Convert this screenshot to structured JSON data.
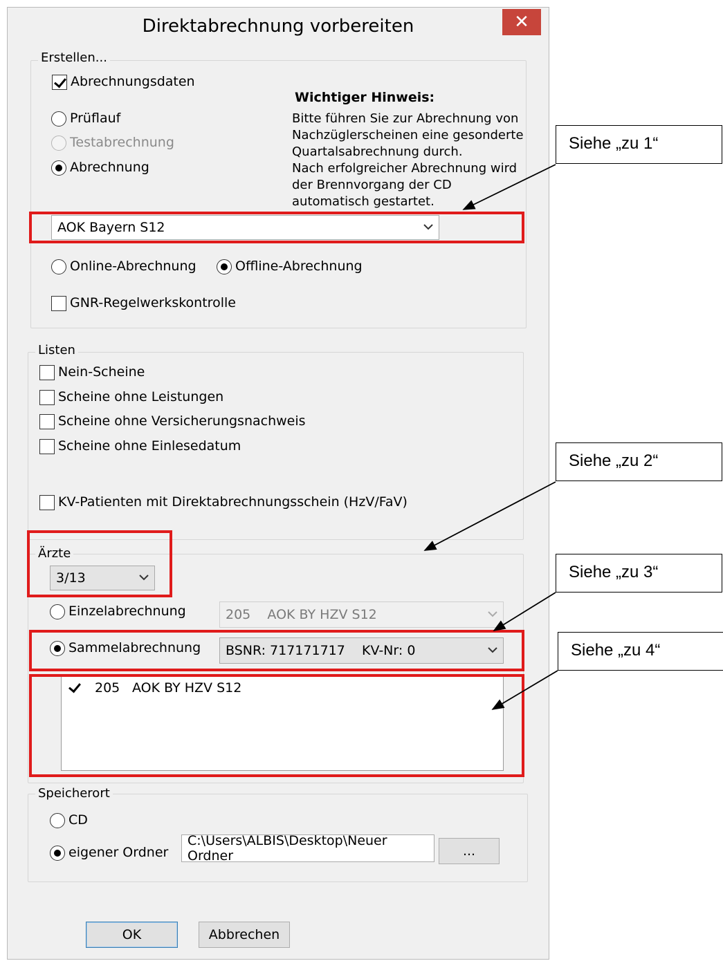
{
  "window": {
    "title": "Direktabrechnung vorbereiten",
    "close_label": "✕"
  },
  "erstellen": {
    "legend": "Erstellen...",
    "abrechnungsdaten_label": "Abrechnungsdaten",
    "abrechnungsdaten_checked": true,
    "hint_title": "Wichtiger Hinweis:",
    "hint_lines": [
      "Bitte führen Sie zur Abrechnung von",
      "Nachzüglerscheinen eine gesonderte",
      "Quartalsabrechnung durch.",
      "Nach erfolgreicher Abrechnung wird",
      "der Brennvorgang der CD",
      "automatisch gestartet."
    ],
    "mode_options": [
      "Prüflauf",
      "Testabrechnung",
      "Abrechnung"
    ],
    "mode_selected": "Abrechnung",
    "kasse_value": "AOK Bayern S12",
    "online_label": "Online-Abrechnung",
    "offline_label": "Offline-Abrechnung",
    "transfer_selected": "Offline-Abrechnung",
    "gnr_label": "GNR-Regelwerkskontrolle",
    "gnr_checked": false
  },
  "listen": {
    "legend": "Listen",
    "items": [
      "Nein-Scheine",
      "Scheine ohne Leistungen",
      "Scheine ohne Versicherungsnachweis",
      "Scheine ohne Einlesedatum"
    ],
    "kv_label": "KV-Patienten mit Direktabrechnungsschein (HzV/FaV)"
  },
  "aerzte": {
    "legend": "Ärzte",
    "select_value": "3/13",
    "einzel_label": "Einzelabrechnung",
    "einzel_value": "205    AOK BY HZV S12",
    "sammel_label": "Sammelabrechnung",
    "sammel_value": "BSNR: 717171717    KV-Nr: 0",
    "mode_selected": "Sammelabrechnung",
    "list_items": [
      {
        "nr": "205",
        "name": "AOK BY HZV S12",
        "checked": true
      }
    ]
  },
  "speicherort": {
    "legend": "Speicherort",
    "cd_label": "CD",
    "folder_label": "eigener Ordner",
    "selected": "eigener Ordner",
    "path_value": "C:\\Users\\ALBIS\\Desktop\\Neuer Ordner",
    "browse_label": "..."
  },
  "buttons": {
    "ok_label": "OK",
    "cancel_label": "Abbrechen"
  },
  "callouts": [
    "Siehe „zu 1“",
    "Siehe „zu 2“",
    "Siehe „zu 3“",
    "Siehe „zu 4“"
  ],
  "colors": {
    "highlight": "#e01b1b",
    "close_button": "#c7453b",
    "window_bg": "#f0f0f0"
  }
}
